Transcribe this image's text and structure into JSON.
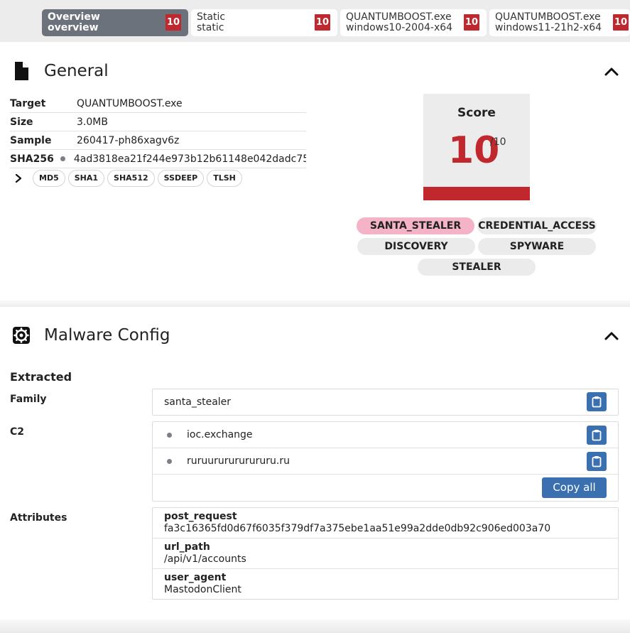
{
  "tabs": [
    {
      "line1": "Overview",
      "line2": "overview",
      "score": "10"
    },
    {
      "line1": "Static",
      "line2": "static",
      "score": "10"
    },
    {
      "line1": "QUANTUMBOOST.exe",
      "line2": "windows10-2004-x64",
      "score": "10"
    },
    {
      "line1": "QUANTUMBOOST.exe",
      "line2": "windows11-21h2-x64",
      "score": "10"
    }
  ],
  "general": {
    "title": "General",
    "rows": [
      {
        "key": "Target",
        "value": "QUANTUMBOOST.exe"
      },
      {
        "key": "Size",
        "value": "3.0MB"
      },
      {
        "key": "Sample",
        "value": "260417-ph86xagv6z"
      },
      {
        "key": "SHA256",
        "value": "4ad3818ea21f244e973b12b61148e042dadc75..."
      }
    ],
    "hashes": [
      "MD5",
      "SHA1",
      "SHA512",
      "SSDEEP",
      "TLSH"
    ],
    "score_label": "Score",
    "score_value": "10",
    "score_max": "/10",
    "tags": [
      "SANTA_STEALER",
      "CREDENTIAL_ACCESS",
      "DISCOVERY",
      "SPYWARE",
      "STEALER"
    ]
  },
  "config": {
    "title": "Malware Config",
    "extracted_label": "Extracted",
    "family_label": "Family",
    "family_value": "santa_stealer",
    "c2_label": "C2",
    "c2": [
      "ioc.exchange",
      "ruruururururururu.ru"
    ],
    "copy_all": "Copy all",
    "attributes_label": "Attributes",
    "attributes": [
      {
        "key": "post_request",
        "value": "fa3c16365fd0d67f6035f379df7a375ebe1aa51e99a2dde0db92c906ed003a70"
      },
      {
        "key": "url_path",
        "value": "/api/v1/accounts"
      },
      {
        "key": "user_agent",
        "value": "MastodonClient"
      }
    ]
  },
  "colors": {
    "accent": "#3a6fb0",
    "danger": "#c0282d",
    "tab_active": "#6b727b",
    "tag_pink": "#f4b3c6"
  }
}
